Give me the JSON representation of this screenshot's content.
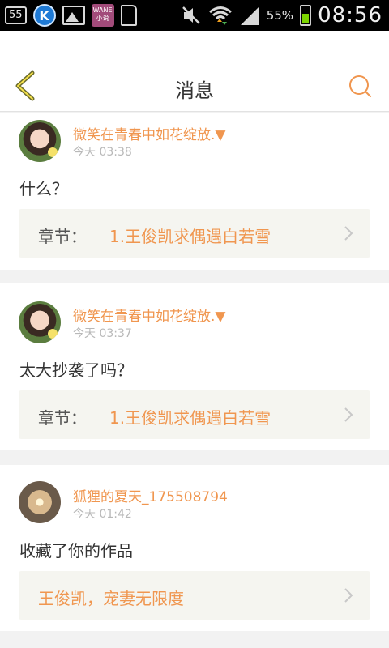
{
  "status_bar": {
    "notif_count": "55",
    "k_app": "K",
    "novel_app": "WANE 小说",
    "battery_pct": "55%",
    "battery_level": 0.55,
    "time": "08:56"
  },
  "header": {
    "title": "消息",
    "accent_color": "#f0964f"
  },
  "messages": [
    {
      "user": "微笑在青春中如花绽放.",
      "marker": "▼",
      "time": "今天 03:38",
      "content": "什么？",
      "ref_prefix": "章节：",
      "ref_text": "1.王俊凯求偶遇白若雪",
      "avatar_icon": "girl-avatar"
    },
    {
      "user": "微笑在青春中如花绽放.",
      "marker": "▼",
      "time": "今天 03:37",
      "content": "太大抄袭了吗？",
      "ref_prefix": "章节：",
      "ref_text": "1.王俊凯求偶遇白若雪",
      "avatar_icon": "girl-avatar"
    },
    {
      "user": "狐狸的夏天_175508794",
      "time": "今天 01:42",
      "content": "收藏了你的作品",
      "ref_text": "王俊凯，宠妻无限度",
      "avatar_icon": "fox-avatar"
    }
  ]
}
